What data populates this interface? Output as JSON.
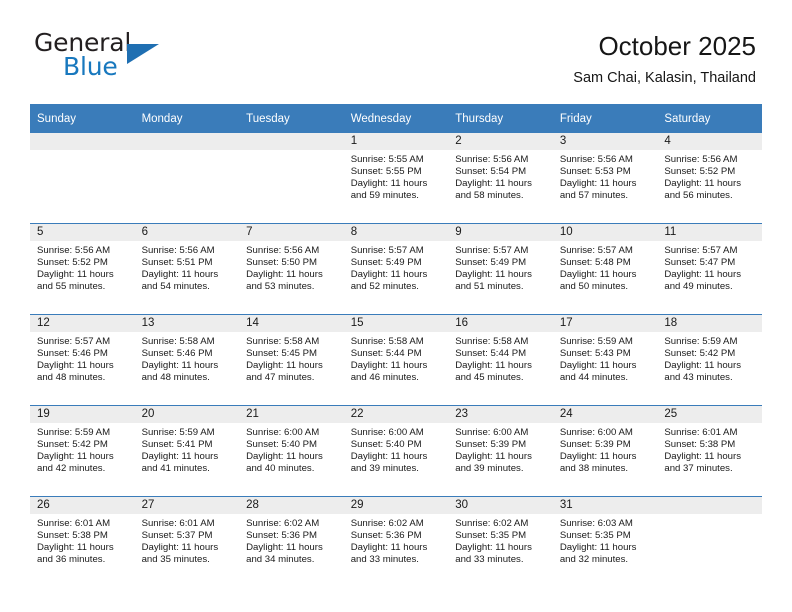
{
  "brand": {
    "line1": "General",
    "line2": "Blue",
    "flag_color": "#1f6fb2",
    "text_color": "#231f20",
    "accent_color": "#1878be"
  },
  "header": {
    "title": "October 2025",
    "subtitle": "Sam Chai, Kalasin, Thailand"
  },
  "theme": {
    "header_bg": "#3a7cba",
    "header_text": "#ffffff",
    "daynum_bg": "#ededed",
    "row_rule": "#3a7cba"
  },
  "calendar": {
    "weekday_headers": [
      "Sunday",
      "Monday",
      "Tuesday",
      "Wednesday",
      "Thursday",
      "Friday",
      "Saturday"
    ],
    "weeks": [
      [
        {
          "day": "",
          "sunrise": "",
          "sunset": "",
          "daylight": ""
        },
        {
          "day": "",
          "sunrise": "",
          "sunset": "",
          "daylight": ""
        },
        {
          "day": "",
          "sunrise": "",
          "sunset": "",
          "daylight": ""
        },
        {
          "day": "1",
          "sunrise": "Sunrise: 5:55 AM",
          "sunset": "Sunset: 5:55 PM",
          "daylight": "Daylight: 11 hours and 59 minutes."
        },
        {
          "day": "2",
          "sunrise": "Sunrise: 5:56 AM",
          "sunset": "Sunset: 5:54 PM",
          "daylight": "Daylight: 11 hours and 58 minutes."
        },
        {
          "day": "3",
          "sunrise": "Sunrise: 5:56 AM",
          "sunset": "Sunset: 5:53 PM",
          "daylight": "Daylight: 11 hours and 57 minutes."
        },
        {
          "day": "4",
          "sunrise": "Sunrise: 5:56 AM",
          "sunset": "Sunset: 5:52 PM",
          "daylight": "Daylight: 11 hours and 56 minutes."
        }
      ],
      [
        {
          "day": "5",
          "sunrise": "Sunrise: 5:56 AM",
          "sunset": "Sunset: 5:52 PM",
          "daylight": "Daylight: 11 hours and 55 minutes."
        },
        {
          "day": "6",
          "sunrise": "Sunrise: 5:56 AM",
          "sunset": "Sunset: 5:51 PM",
          "daylight": "Daylight: 11 hours and 54 minutes."
        },
        {
          "day": "7",
          "sunrise": "Sunrise: 5:56 AM",
          "sunset": "Sunset: 5:50 PM",
          "daylight": "Daylight: 11 hours and 53 minutes."
        },
        {
          "day": "8",
          "sunrise": "Sunrise: 5:57 AM",
          "sunset": "Sunset: 5:49 PM",
          "daylight": "Daylight: 11 hours and 52 minutes."
        },
        {
          "day": "9",
          "sunrise": "Sunrise: 5:57 AM",
          "sunset": "Sunset: 5:49 PM",
          "daylight": "Daylight: 11 hours and 51 minutes."
        },
        {
          "day": "10",
          "sunrise": "Sunrise: 5:57 AM",
          "sunset": "Sunset: 5:48 PM",
          "daylight": "Daylight: 11 hours and 50 minutes."
        },
        {
          "day": "11",
          "sunrise": "Sunrise: 5:57 AM",
          "sunset": "Sunset: 5:47 PM",
          "daylight": "Daylight: 11 hours and 49 minutes."
        }
      ],
      [
        {
          "day": "12",
          "sunrise": "Sunrise: 5:57 AM",
          "sunset": "Sunset: 5:46 PM",
          "daylight": "Daylight: 11 hours and 48 minutes."
        },
        {
          "day": "13",
          "sunrise": "Sunrise: 5:58 AM",
          "sunset": "Sunset: 5:46 PM",
          "daylight": "Daylight: 11 hours and 48 minutes."
        },
        {
          "day": "14",
          "sunrise": "Sunrise: 5:58 AM",
          "sunset": "Sunset: 5:45 PM",
          "daylight": "Daylight: 11 hours and 47 minutes."
        },
        {
          "day": "15",
          "sunrise": "Sunrise: 5:58 AM",
          "sunset": "Sunset: 5:44 PM",
          "daylight": "Daylight: 11 hours and 46 minutes."
        },
        {
          "day": "16",
          "sunrise": "Sunrise: 5:58 AM",
          "sunset": "Sunset: 5:44 PM",
          "daylight": "Daylight: 11 hours and 45 minutes."
        },
        {
          "day": "17",
          "sunrise": "Sunrise: 5:59 AM",
          "sunset": "Sunset: 5:43 PM",
          "daylight": "Daylight: 11 hours and 44 minutes."
        },
        {
          "day": "18",
          "sunrise": "Sunrise: 5:59 AM",
          "sunset": "Sunset: 5:42 PM",
          "daylight": "Daylight: 11 hours and 43 minutes."
        }
      ],
      [
        {
          "day": "19",
          "sunrise": "Sunrise: 5:59 AM",
          "sunset": "Sunset: 5:42 PM",
          "daylight": "Daylight: 11 hours and 42 minutes."
        },
        {
          "day": "20",
          "sunrise": "Sunrise: 5:59 AM",
          "sunset": "Sunset: 5:41 PM",
          "daylight": "Daylight: 11 hours and 41 minutes."
        },
        {
          "day": "21",
          "sunrise": "Sunrise: 6:00 AM",
          "sunset": "Sunset: 5:40 PM",
          "daylight": "Daylight: 11 hours and 40 minutes."
        },
        {
          "day": "22",
          "sunrise": "Sunrise: 6:00 AM",
          "sunset": "Sunset: 5:40 PM",
          "daylight": "Daylight: 11 hours and 39 minutes."
        },
        {
          "day": "23",
          "sunrise": "Sunrise: 6:00 AM",
          "sunset": "Sunset: 5:39 PM",
          "daylight": "Daylight: 11 hours and 39 minutes."
        },
        {
          "day": "24",
          "sunrise": "Sunrise: 6:00 AM",
          "sunset": "Sunset: 5:39 PM",
          "daylight": "Daylight: 11 hours and 38 minutes."
        },
        {
          "day": "25",
          "sunrise": "Sunrise: 6:01 AM",
          "sunset": "Sunset: 5:38 PM",
          "daylight": "Daylight: 11 hours and 37 minutes."
        }
      ],
      [
        {
          "day": "26",
          "sunrise": "Sunrise: 6:01 AM",
          "sunset": "Sunset: 5:38 PM",
          "daylight": "Daylight: 11 hours and 36 minutes."
        },
        {
          "day": "27",
          "sunrise": "Sunrise: 6:01 AM",
          "sunset": "Sunset: 5:37 PM",
          "daylight": "Daylight: 11 hours and 35 minutes."
        },
        {
          "day": "28",
          "sunrise": "Sunrise: 6:02 AM",
          "sunset": "Sunset: 5:36 PM",
          "daylight": "Daylight: 11 hours and 34 minutes."
        },
        {
          "day": "29",
          "sunrise": "Sunrise: 6:02 AM",
          "sunset": "Sunset: 5:36 PM",
          "daylight": "Daylight: 11 hours and 33 minutes."
        },
        {
          "day": "30",
          "sunrise": "Sunrise: 6:02 AM",
          "sunset": "Sunset: 5:35 PM",
          "daylight": "Daylight: 11 hours and 33 minutes."
        },
        {
          "day": "31",
          "sunrise": "Sunrise: 6:03 AM",
          "sunset": "Sunset: 5:35 PM",
          "daylight": "Daylight: 11 hours and 32 minutes."
        },
        {
          "day": "",
          "sunrise": "",
          "sunset": "",
          "daylight": ""
        }
      ]
    ]
  }
}
